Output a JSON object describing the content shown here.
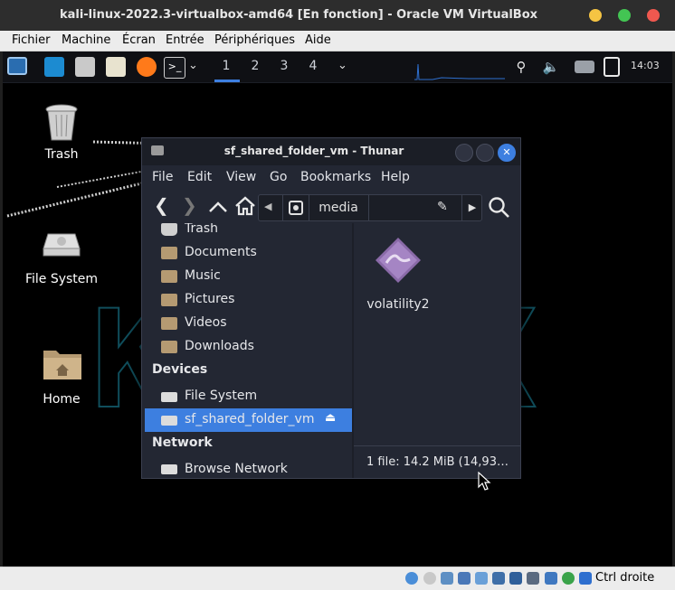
{
  "host": {
    "title": "kali-linux-2022.3-virtualbox-amd64 [En fonction] - Oracle VM VirtualBox",
    "window_controls": {
      "minimize_color": "#f5c443",
      "maximize_color": "#43c553",
      "close_color": "#f0584f"
    },
    "menu": [
      "Fichier",
      "Machine",
      "Écran",
      "Entrée",
      "Périphériques",
      "Aide"
    ],
    "status": {
      "host_key_label": "Ctrl droite"
    }
  },
  "guest": {
    "panel": {
      "workspaces": [
        "1",
        "2",
        "3",
        "4"
      ],
      "active_workspace": "1",
      "clock": "14:03",
      "icons": [
        "show-desktop-icon",
        "window-icon",
        "files-icon",
        "text-editor-icon",
        "firefox-icon",
        "terminal-icon"
      ]
    },
    "desktop_icons": [
      {
        "label": "Trash",
        "icon": "trash-icon"
      },
      {
        "label": "File System",
        "icon": "drive-icon"
      },
      {
        "label": "Home",
        "icon": "home-folder-icon"
      }
    ],
    "thunar": {
      "title": "sf_shared_folder_vm - Thunar",
      "menu": [
        "File",
        "Edit",
        "View",
        "Go",
        "Bookmarks",
        "Help"
      ],
      "path": {
        "current": "media"
      },
      "sidebar": {
        "places": [
          {
            "label": "Trash",
            "icon": "trash-icon"
          },
          {
            "label": "Documents",
            "icon": "folder-documents-icon"
          },
          {
            "label": "Music",
            "icon": "folder-music-icon"
          },
          {
            "label": "Pictures",
            "icon": "folder-pictures-icon"
          },
          {
            "label": "Videos",
            "icon": "folder-videos-icon"
          },
          {
            "label": "Downloads",
            "icon": "folder-downloads-icon"
          }
        ],
        "devices_header": "Devices",
        "devices": [
          {
            "label": "File System",
            "icon": "drive-icon",
            "selected": false
          },
          {
            "label": "sf_shared_folder_vm",
            "icon": "drive-icon",
            "selected": true
          }
        ],
        "network_header": "Network",
        "network": [
          {
            "label": "Browse Network",
            "icon": "network-icon"
          }
        ]
      },
      "files": [
        {
          "name": "volatility2",
          "icon": "executable-icon"
        }
      ],
      "status": "1 file: 14.2 MiB (14,93…",
      "selection_color": "#3d7fe0"
    }
  }
}
